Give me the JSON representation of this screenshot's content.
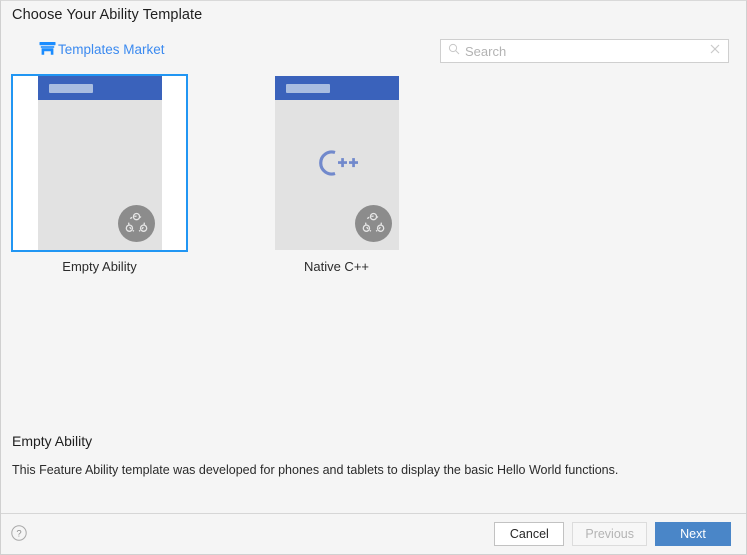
{
  "window": {
    "title": "Choose Your Ability Template"
  },
  "header": {
    "market_link": {
      "label": "Templates Market",
      "icon": "shop-icon",
      "color": "#3b8af0"
    }
  },
  "search": {
    "placeholder": "Search",
    "value": "",
    "search_icon": "search-icon",
    "clear_icon": "close-icon"
  },
  "templates": [
    {
      "id": "empty-ability",
      "label": "Empty Ability",
      "selected": true,
      "thumbnail": {
        "header_color": "#3a62bb",
        "body_color": "#e2e2e2",
        "badge_icon": "harmony-ability-icon",
        "center_icon": ""
      }
    },
    {
      "id": "native-cpp",
      "label": "Native C++",
      "selected": false,
      "thumbnail": {
        "header_color": "#3a62bb",
        "body_color": "#e2e2e2",
        "badge_icon": "harmony-ability-icon",
        "center_icon": "cpp-logo-icon"
      }
    }
  ],
  "description": {
    "title": "Empty Ability",
    "text": "This Feature Ability template was developed for phones and tablets to display the basic Hello World functions."
  },
  "footer": {
    "help_icon": "help-icon",
    "buttons": {
      "cancel": "Cancel",
      "previous": "Previous",
      "next": "Next"
    },
    "previous_enabled": false,
    "accent_color": "#4a86c8"
  }
}
